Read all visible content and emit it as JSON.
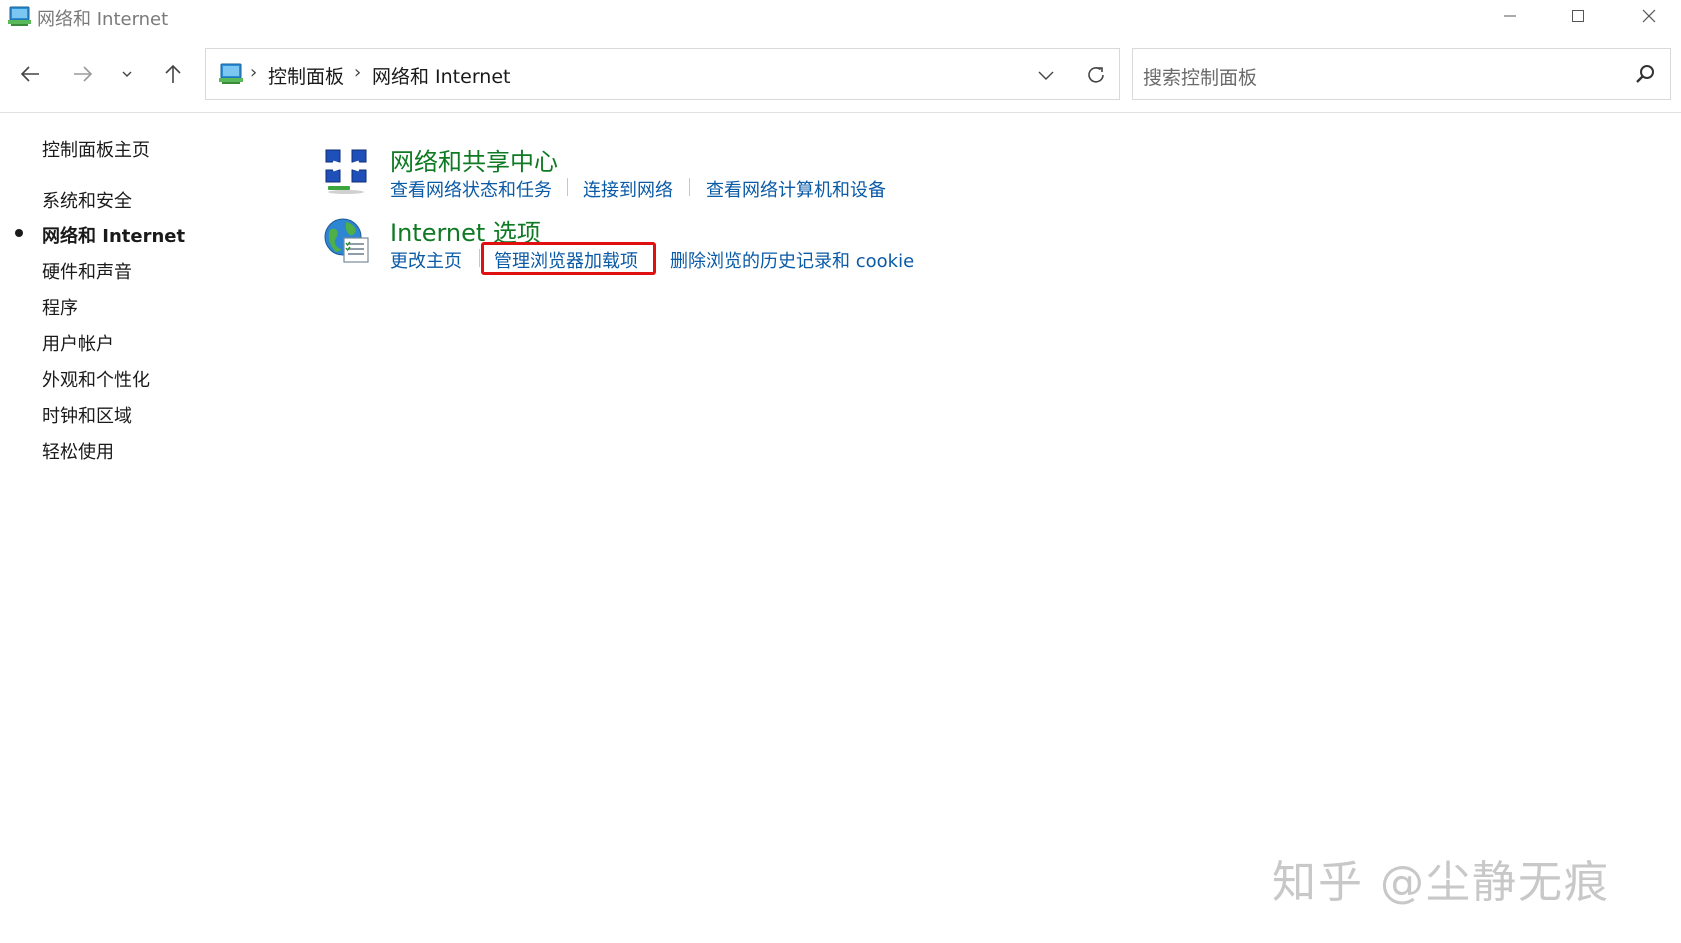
{
  "window": {
    "title": "网络和 Internet"
  },
  "address": {
    "crumbs": [
      "控制面板",
      "网络和 Internet"
    ]
  },
  "search": {
    "placeholder": "搜索控制面板"
  },
  "sidebar": {
    "items": [
      {
        "label": "控制面板主页",
        "active": false
      },
      {
        "label": "系统和安全",
        "active": false
      },
      {
        "label": "网络和 Internet",
        "active": true
      },
      {
        "label": "硬件和声音",
        "active": false
      },
      {
        "label": "程序",
        "active": false
      },
      {
        "label": "用户帐户",
        "active": false
      },
      {
        "label": "外观和个性化",
        "active": false
      },
      {
        "label": "时钟和区域",
        "active": false
      },
      {
        "label": "轻松使用",
        "active": false
      }
    ]
  },
  "categories": [
    {
      "title": "网络和共享中心",
      "icon": "network-sharing-center-icon",
      "links": [
        "查看网络状态和任务",
        "连接到网络",
        "查看网络计算机和设备"
      ]
    },
    {
      "title": "Internet 选项",
      "icon": "internet-options-icon",
      "links": [
        "更改主页",
        "管理浏览器加载项",
        "删除浏览的历史记录和 cookie"
      ]
    }
  ],
  "annotation": {
    "highlighted_link": "管理浏览器加载项",
    "color": "#e01010"
  },
  "watermark": {
    "text": "知乎 @尘静无痕"
  },
  "colors": {
    "category_title": "#0f7a23",
    "link": "#0a5aa6"
  }
}
